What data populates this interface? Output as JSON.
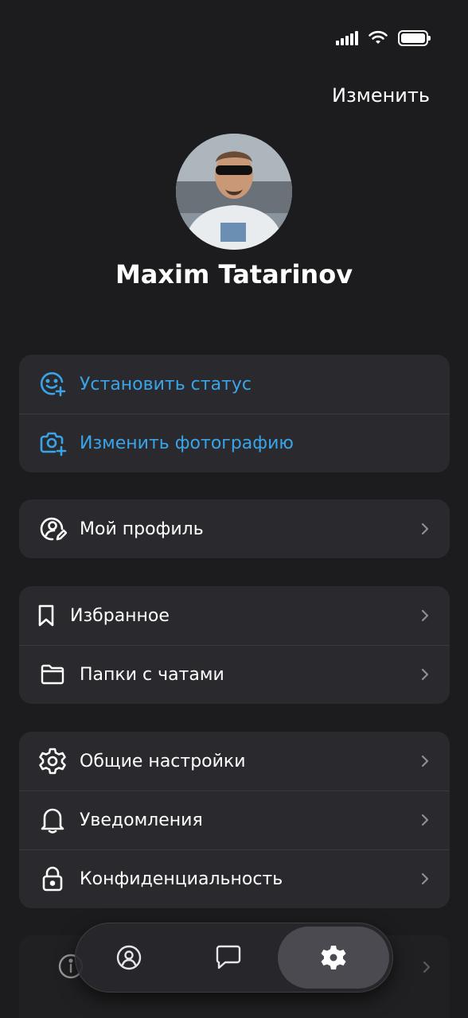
{
  "header": {
    "edit_label": "Изменить"
  },
  "profile": {
    "name": "Maxim Tatarinov"
  },
  "quick_actions": {
    "set_status": "Установить статус",
    "change_photo": "Изменить фотографию"
  },
  "account": {
    "my_profile": "Мой профиль"
  },
  "library": {
    "favorites": "Избранное",
    "chat_folders": "Папки с чатами"
  },
  "settings": {
    "general": "Общие настройки",
    "notifications": "Уведомления",
    "privacy": "Конфиденциальность"
  },
  "colors": {
    "accent": "#3aa4e8",
    "background": "#1c1c1e",
    "card": "#2a2a2e"
  },
  "tabbar": {
    "tabs": [
      "profile-icon",
      "chat-icon",
      "settings-icon"
    ],
    "active": "settings-icon"
  }
}
